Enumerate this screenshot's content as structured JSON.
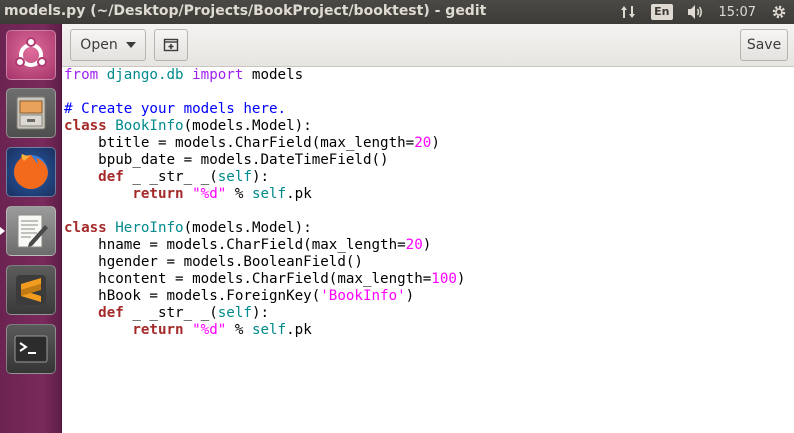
{
  "window": {
    "title": "models.py (~/Desktop/Projects/BookProject/booktest) - gedit"
  },
  "panel": {
    "language": "En",
    "time": "15:07"
  },
  "launcher": {
    "items": [
      "ubuntu-dash",
      "files",
      "firefox",
      "text-editor",
      "sublime-text",
      "terminal"
    ]
  },
  "toolbar": {
    "open_label": "Open",
    "save_label": "Save"
  },
  "editor": {
    "lines": [
      [
        [
          "kw",
          "from"
        ],
        [
          "txt",
          " "
        ],
        [
          "mod",
          "django.db"
        ],
        [
          "txt",
          " "
        ],
        [
          "kw",
          "import"
        ],
        [
          "txt",
          " models"
        ]
      ],
      [],
      [
        [
          "cmt",
          "# Create your models here."
        ]
      ],
      [
        [
          "kwb",
          "class"
        ],
        [
          "txt",
          " "
        ],
        [
          "cls",
          "BookInfo"
        ],
        [
          "txt",
          "(models.Model):"
        ]
      ],
      [
        [
          "txt",
          "    btitle = models.CharField(max_length="
        ],
        [
          "num",
          "20"
        ],
        [
          "txt",
          ")"
        ]
      ],
      [
        [
          "txt",
          "    bpub_date = models.DateTimeField()"
        ]
      ],
      [
        [
          "txt",
          "    "
        ],
        [
          "kwb",
          "def"
        ],
        [
          "txt",
          " _ _str_ _("
        ],
        [
          "self",
          "self"
        ],
        [
          "txt",
          "):"
        ]
      ],
      [
        [
          "txt",
          "        "
        ],
        [
          "kwb",
          "return"
        ],
        [
          "txt",
          " "
        ],
        [
          "str",
          "\"%d\""
        ],
        [
          "txt",
          " % "
        ],
        [
          "self",
          "self"
        ],
        [
          "txt",
          ".pk"
        ]
      ],
      [],
      [
        [
          "kwb",
          "class"
        ],
        [
          "txt",
          " "
        ],
        [
          "cls",
          "HeroInfo"
        ],
        [
          "txt",
          "(models.Model):"
        ]
      ],
      [
        [
          "txt",
          "    hname = models.CharField(max_length="
        ],
        [
          "num",
          "20"
        ],
        [
          "txt",
          ")"
        ]
      ],
      [
        [
          "txt",
          "    hgender = models.BooleanField()"
        ]
      ],
      [
        [
          "txt",
          "    hcontent = models.CharField(max_length="
        ],
        [
          "num",
          "100"
        ],
        [
          "txt",
          ")"
        ]
      ],
      [
        [
          "txt",
          "    hBook = models.ForeignKey("
        ],
        [
          "str",
          "'BookInfo'"
        ],
        [
          "txt",
          ")"
        ]
      ],
      [
        [
          "txt",
          "    "
        ],
        [
          "kwb",
          "def"
        ],
        [
          "txt",
          " _ _str_ _("
        ],
        [
          "self",
          "self"
        ],
        [
          "txt",
          "):"
        ]
      ],
      [
        [
          "txt",
          "        "
        ],
        [
          "kwb",
          "return"
        ],
        [
          "txt",
          " "
        ],
        [
          "str",
          "\"%d\""
        ],
        [
          "txt",
          " % "
        ],
        [
          "self",
          "self"
        ],
        [
          "txt",
          ".pk"
        ]
      ]
    ]
  },
  "colors": {
    "launcher_bg": "#7a2a5c",
    "keyword": "#a020f0",
    "keyword_bold": "#a52a2a",
    "class_name": "#008a8c",
    "string": "#ff00ff",
    "comment": "#0000ff"
  }
}
